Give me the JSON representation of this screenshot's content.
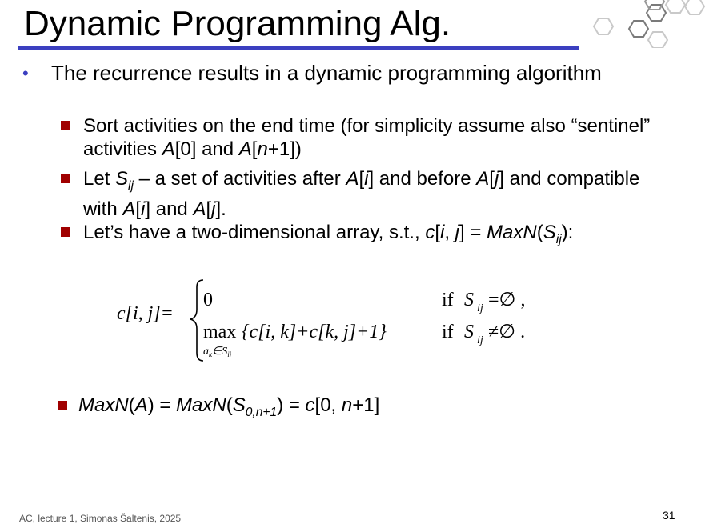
{
  "slide": {
    "title": "Dynamic Programming Alg.",
    "bullet_main": {
      "text_plain": "The recurrence results in a dynamic programming algorithm"
    },
    "sub_bullets": [
      {
        "t1": "Sort activities on the end time (for simplicity assume also “sentinel” activities ",
        "A": "A",
        "t2": "[0] and ",
        "A2": "A",
        "t3": "[",
        "n": "n",
        "t4": "+1])"
      },
      {
        "t1": "Let ",
        "S": "S",
        "ij": "ij",
        "t2": " – a set of activities after ",
        "A1": "A",
        "b1": "[",
        "i1": "i",
        "b2": "] and before ",
        "A2": "A",
        "b3": "[",
        "j1": "j",
        "b4": "] and compatible with ",
        "A3": "A",
        "b5": "[",
        "i2": "i",
        "b6": "] and ",
        "A4": "A",
        "b7": "[",
        "j2": "j",
        "b8": "]."
      },
      {
        "t1": "Let’s have a two-dimensional array, s.t., ",
        "c": "c",
        "b1": "[",
        "i": "i",
        "comma": ", ",
        "j": "j",
        "b2": "] = ",
        "maxn": "MaxN",
        "p1": "(",
        "S": "S",
        "ij": "ij",
        "p2": "):"
      }
    ],
    "formula": {
      "lhs": "c[i, j]=",
      "case1_value": "0",
      "case1_cond_if": "if",
      "case1_S": "S",
      "case1_sub": "ij",
      "case1_rel": "=∅ ,",
      "case2_max": "max",
      "case2_expr": "{c[i, k]+c[k, j]+1}",
      "case2_under": "a",
      "case2_under_k": "k",
      "case2_under_rest": "∈S",
      "case2_under_ij": "ij",
      "case2_cond_if": "if",
      "case2_S": "S",
      "case2_sub": "ij",
      "case2_rel": "≠∅ ."
    },
    "last_bullet": {
      "maxn1": "MaxN",
      "p1": "(",
      "A": "A",
      "p2": ") = ",
      "maxn2": "MaxN",
      "p3": "(",
      "S": "S",
      "sub": "0,n+1",
      "p4": ") = ",
      "c": "c",
      "t1": "[0, ",
      "n": "n",
      "t2": "+1]"
    },
    "footer": "AC, lecture 1, Simonas Šaltenis, 2025",
    "page_number": "31"
  },
  "colors": {
    "title_rule": "#3b3fc0",
    "bullet_dot": "#3b3fc0",
    "sub_bullet": "#a00000"
  }
}
